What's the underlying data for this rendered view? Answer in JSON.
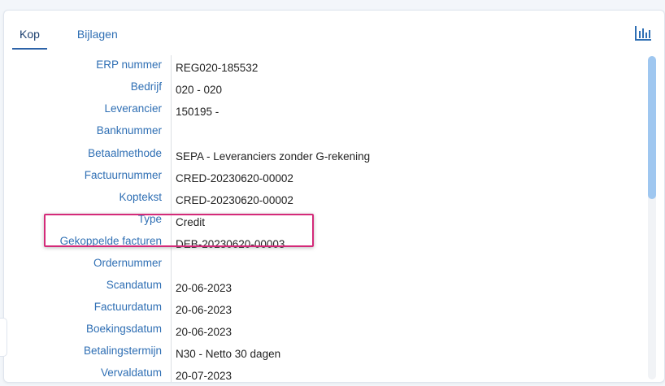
{
  "tabs": [
    {
      "label": "Kop",
      "active": true
    },
    {
      "label": "Bijlagen",
      "active": false
    }
  ],
  "toolbar": {
    "chart_icon": "bar-chart-icon"
  },
  "colors": {
    "label": "#2f6fb4",
    "highlight": "#d42a79",
    "scrollbar": "#9fc7f0"
  },
  "fields": [
    {
      "label": "ERP nummer",
      "value": "REG020-185532"
    },
    {
      "label": "Bedrijf",
      "value": "020 - 020"
    },
    {
      "label": "Leverancier",
      "value": "150195 -"
    },
    {
      "label": "Banknummer",
      "value": ""
    },
    {
      "label": "Betaalmethode",
      "value": "SEPA - Leveranciers zonder G-rekening"
    },
    {
      "label": "Factuurnummer",
      "value": "CRED-20230620-00002"
    },
    {
      "label": "Koptekst",
      "value": "CRED-20230620-00002"
    },
    {
      "label": "Type",
      "value": "Credit"
    },
    {
      "label": "Gekoppelde facturen",
      "value": "DEB-20230620-00003"
    },
    {
      "label": "Ordernummer",
      "value": ""
    },
    {
      "label": "Scandatum",
      "value": "20-06-2023"
    },
    {
      "label": "Factuurdatum",
      "value": "20-06-2023"
    },
    {
      "label": "Boekingsdatum",
      "value": "20-06-2023"
    },
    {
      "label": "Betalingstermijn",
      "value": "N30 - Netto 30 dagen"
    },
    {
      "label": "Vervaldatum",
      "value": "20-07-2023"
    }
  ]
}
